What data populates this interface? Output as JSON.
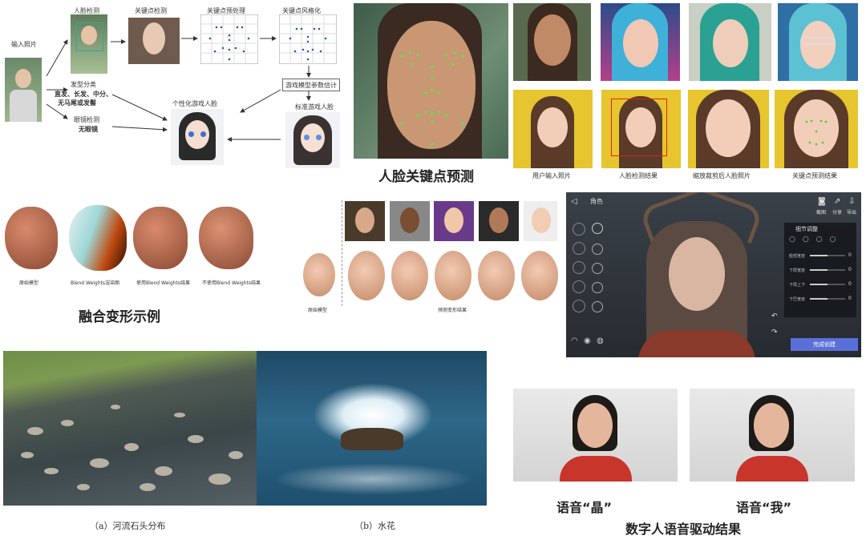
{
  "pipeline": {
    "input_label": "输入照片",
    "face_detect": "人脸检测",
    "keypoint_detect": "关键点检测",
    "keypoint_preprocess": "关键点预处理",
    "keypoint_stylize": "关键点风格化",
    "hair_class": "发型分类",
    "hair_types": "直发、长发、中分、",
    "hair_types2": "无马尾或发髻",
    "glasses_detect": "眼镜检测",
    "glasses_none": "无眼镜",
    "personal_face": "个性化游戏人脸",
    "param_stats": "游戏模型参数估计",
    "standard_face": "标准游戏人脸"
  },
  "keypoint_section": {
    "title": "人脸关键点预测",
    "captions": [
      "用户输入照片",
      "人脸检测结果",
      "缩放裁剪后人脸照片",
      "关键点预测结果"
    ]
  },
  "blend_section": {
    "title": "融合变形示例",
    "captions": [
      "原始模型",
      "Blend Weights渲染图",
      "使用Blend Weights结果",
      "不使用Blend Weights结果"
    ]
  },
  "deform_section": {
    "left_caption": "原始模型",
    "right_caption": "预测变形结果"
  },
  "game_ui": {
    "top_tab": "角色",
    "panel_title": "细节调整",
    "sliders": [
      "脸部宽度",
      "下颌宽度",
      "下颌上下",
      "下巴宽度"
    ],
    "slider_values": [
      "0",
      "0",
      "0",
      "0"
    ],
    "confirm": "完成创建",
    "top_icons": [
      "截图",
      "分享",
      "导出"
    ]
  },
  "nature": {
    "caption_a": "（a）河流石头分布",
    "caption_b": "（b）水花"
  },
  "digital_human": {
    "left_caption": "语音“晶”",
    "right_caption": "语音“我”",
    "title": "数字人语音驱动结果"
  }
}
